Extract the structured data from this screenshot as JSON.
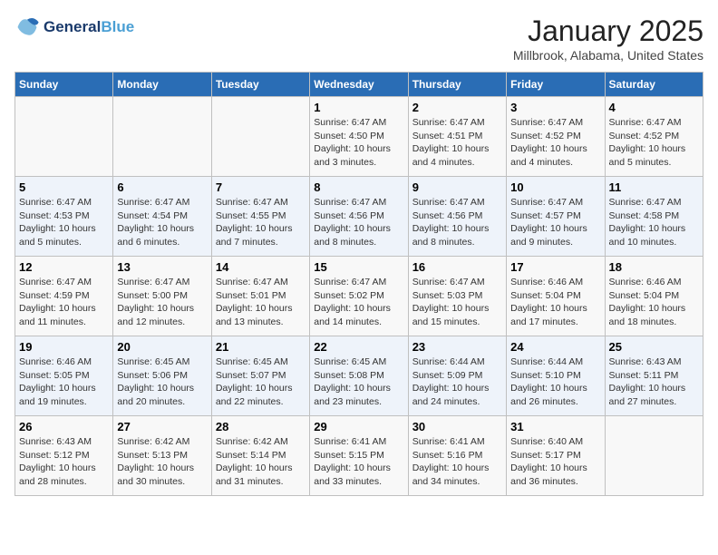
{
  "header": {
    "logo_line1": "General",
    "logo_line2": "Blue",
    "month": "January 2025",
    "location": "Millbrook, Alabama, United States"
  },
  "days_of_week": [
    "Sunday",
    "Monday",
    "Tuesday",
    "Wednesday",
    "Thursday",
    "Friday",
    "Saturday"
  ],
  "weeks": [
    [
      {
        "day": "",
        "info": ""
      },
      {
        "day": "",
        "info": ""
      },
      {
        "day": "",
        "info": ""
      },
      {
        "day": "1",
        "info": "Sunrise: 6:47 AM\nSunset: 4:50 PM\nDaylight: 10 hours\nand 3 minutes."
      },
      {
        "day": "2",
        "info": "Sunrise: 6:47 AM\nSunset: 4:51 PM\nDaylight: 10 hours\nand 4 minutes."
      },
      {
        "day": "3",
        "info": "Sunrise: 6:47 AM\nSunset: 4:52 PM\nDaylight: 10 hours\nand 4 minutes."
      },
      {
        "day": "4",
        "info": "Sunrise: 6:47 AM\nSunset: 4:52 PM\nDaylight: 10 hours\nand 5 minutes."
      }
    ],
    [
      {
        "day": "5",
        "info": "Sunrise: 6:47 AM\nSunset: 4:53 PM\nDaylight: 10 hours\nand 5 minutes."
      },
      {
        "day": "6",
        "info": "Sunrise: 6:47 AM\nSunset: 4:54 PM\nDaylight: 10 hours\nand 6 minutes."
      },
      {
        "day": "7",
        "info": "Sunrise: 6:47 AM\nSunset: 4:55 PM\nDaylight: 10 hours\nand 7 minutes."
      },
      {
        "day": "8",
        "info": "Sunrise: 6:47 AM\nSunset: 4:56 PM\nDaylight: 10 hours\nand 8 minutes."
      },
      {
        "day": "9",
        "info": "Sunrise: 6:47 AM\nSunset: 4:56 PM\nDaylight: 10 hours\nand 8 minutes."
      },
      {
        "day": "10",
        "info": "Sunrise: 6:47 AM\nSunset: 4:57 PM\nDaylight: 10 hours\nand 9 minutes."
      },
      {
        "day": "11",
        "info": "Sunrise: 6:47 AM\nSunset: 4:58 PM\nDaylight: 10 hours\nand 10 minutes."
      }
    ],
    [
      {
        "day": "12",
        "info": "Sunrise: 6:47 AM\nSunset: 4:59 PM\nDaylight: 10 hours\nand 11 minutes."
      },
      {
        "day": "13",
        "info": "Sunrise: 6:47 AM\nSunset: 5:00 PM\nDaylight: 10 hours\nand 12 minutes."
      },
      {
        "day": "14",
        "info": "Sunrise: 6:47 AM\nSunset: 5:01 PM\nDaylight: 10 hours\nand 13 minutes."
      },
      {
        "day": "15",
        "info": "Sunrise: 6:47 AM\nSunset: 5:02 PM\nDaylight: 10 hours\nand 14 minutes."
      },
      {
        "day": "16",
        "info": "Sunrise: 6:47 AM\nSunset: 5:03 PM\nDaylight: 10 hours\nand 15 minutes."
      },
      {
        "day": "17",
        "info": "Sunrise: 6:46 AM\nSunset: 5:04 PM\nDaylight: 10 hours\nand 17 minutes."
      },
      {
        "day": "18",
        "info": "Sunrise: 6:46 AM\nSunset: 5:04 PM\nDaylight: 10 hours\nand 18 minutes."
      }
    ],
    [
      {
        "day": "19",
        "info": "Sunrise: 6:46 AM\nSunset: 5:05 PM\nDaylight: 10 hours\nand 19 minutes."
      },
      {
        "day": "20",
        "info": "Sunrise: 6:45 AM\nSunset: 5:06 PM\nDaylight: 10 hours\nand 20 minutes."
      },
      {
        "day": "21",
        "info": "Sunrise: 6:45 AM\nSunset: 5:07 PM\nDaylight: 10 hours\nand 22 minutes."
      },
      {
        "day": "22",
        "info": "Sunrise: 6:45 AM\nSunset: 5:08 PM\nDaylight: 10 hours\nand 23 minutes."
      },
      {
        "day": "23",
        "info": "Sunrise: 6:44 AM\nSunset: 5:09 PM\nDaylight: 10 hours\nand 24 minutes."
      },
      {
        "day": "24",
        "info": "Sunrise: 6:44 AM\nSunset: 5:10 PM\nDaylight: 10 hours\nand 26 minutes."
      },
      {
        "day": "25",
        "info": "Sunrise: 6:43 AM\nSunset: 5:11 PM\nDaylight: 10 hours\nand 27 minutes."
      }
    ],
    [
      {
        "day": "26",
        "info": "Sunrise: 6:43 AM\nSunset: 5:12 PM\nDaylight: 10 hours\nand 28 minutes."
      },
      {
        "day": "27",
        "info": "Sunrise: 6:42 AM\nSunset: 5:13 PM\nDaylight: 10 hours\nand 30 minutes."
      },
      {
        "day": "28",
        "info": "Sunrise: 6:42 AM\nSunset: 5:14 PM\nDaylight: 10 hours\nand 31 minutes."
      },
      {
        "day": "29",
        "info": "Sunrise: 6:41 AM\nSunset: 5:15 PM\nDaylight: 10 hours\nand 33 minutes."
      },
      {
        "day": "30",
        "info": "Sunrise: 6:41 AM\nSunset: 5:16 PM\nDaylight: 10 hours\nand 34 minutes."
      },
      {
        "day": "31",
        "info": "Sunrise: 6:40 AM\nSunset: 5:17 PM\nDaylight: 10 hours\nand 36 minutes."
      },
      {
        "day": "",
        "info": ""
      }
    ]
  ]
}
